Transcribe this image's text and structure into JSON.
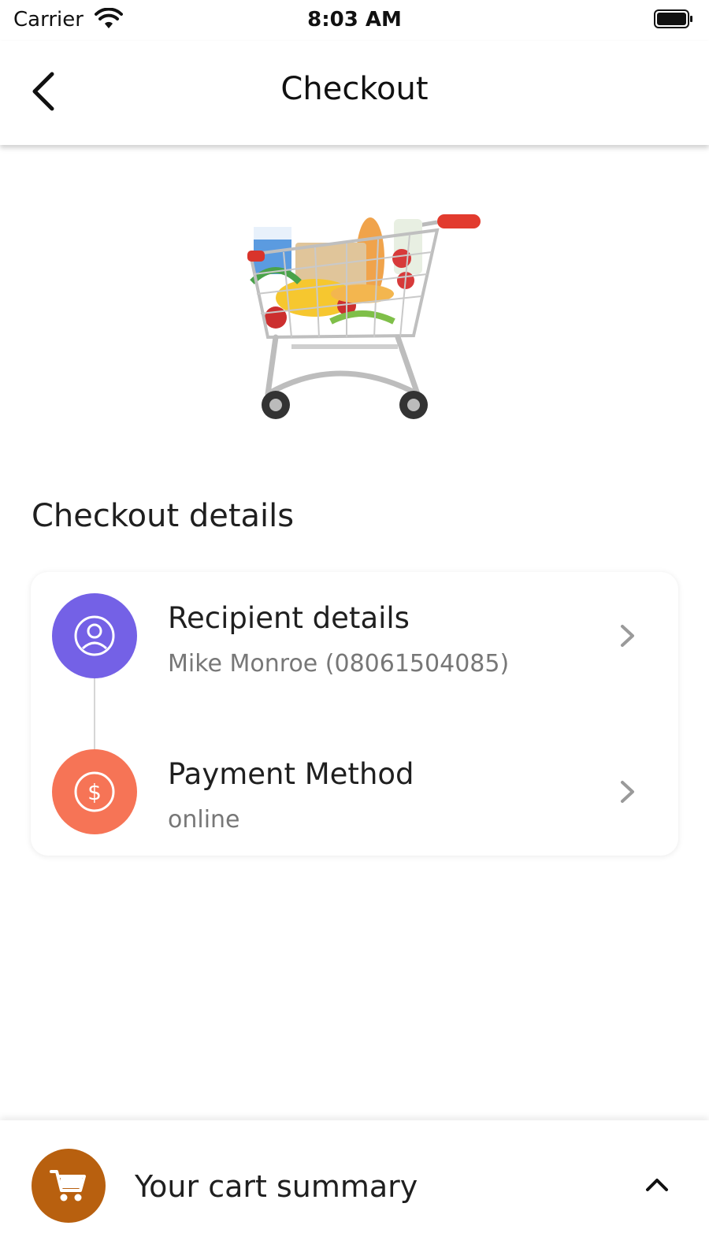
{
  "status_bar": {
    "carrier": "Carrier",
    "time": "8:03 AM"
  },
  "header": {
    "title": "Checkout",
    "back_icon": "chevron-left-icon"
  },
  "illustration": {
    "name": "shopping-cart-with-groceries"
  },
  "checkout_details": {
    "title": "Checkout details",
    "items": [
      {
        "title": "Recipient details",
        "subtitle": "Mike Monroe (08061504085)",
        "icon": "user-icon",
        "color": "#7461e6"
      },
      {
        "title": "Payment Method",
        "subtitle": "online",
        "icon": "dollar-icon",
        "color": "#f67456"
      }
    ]
  },
  "cart_summary": {
    "label": "Your cart summary",
    "icon": "cart-icon",
    "color": "#b8600f",
    "toggle_icon": "chevron-up-icon"
  }
}
